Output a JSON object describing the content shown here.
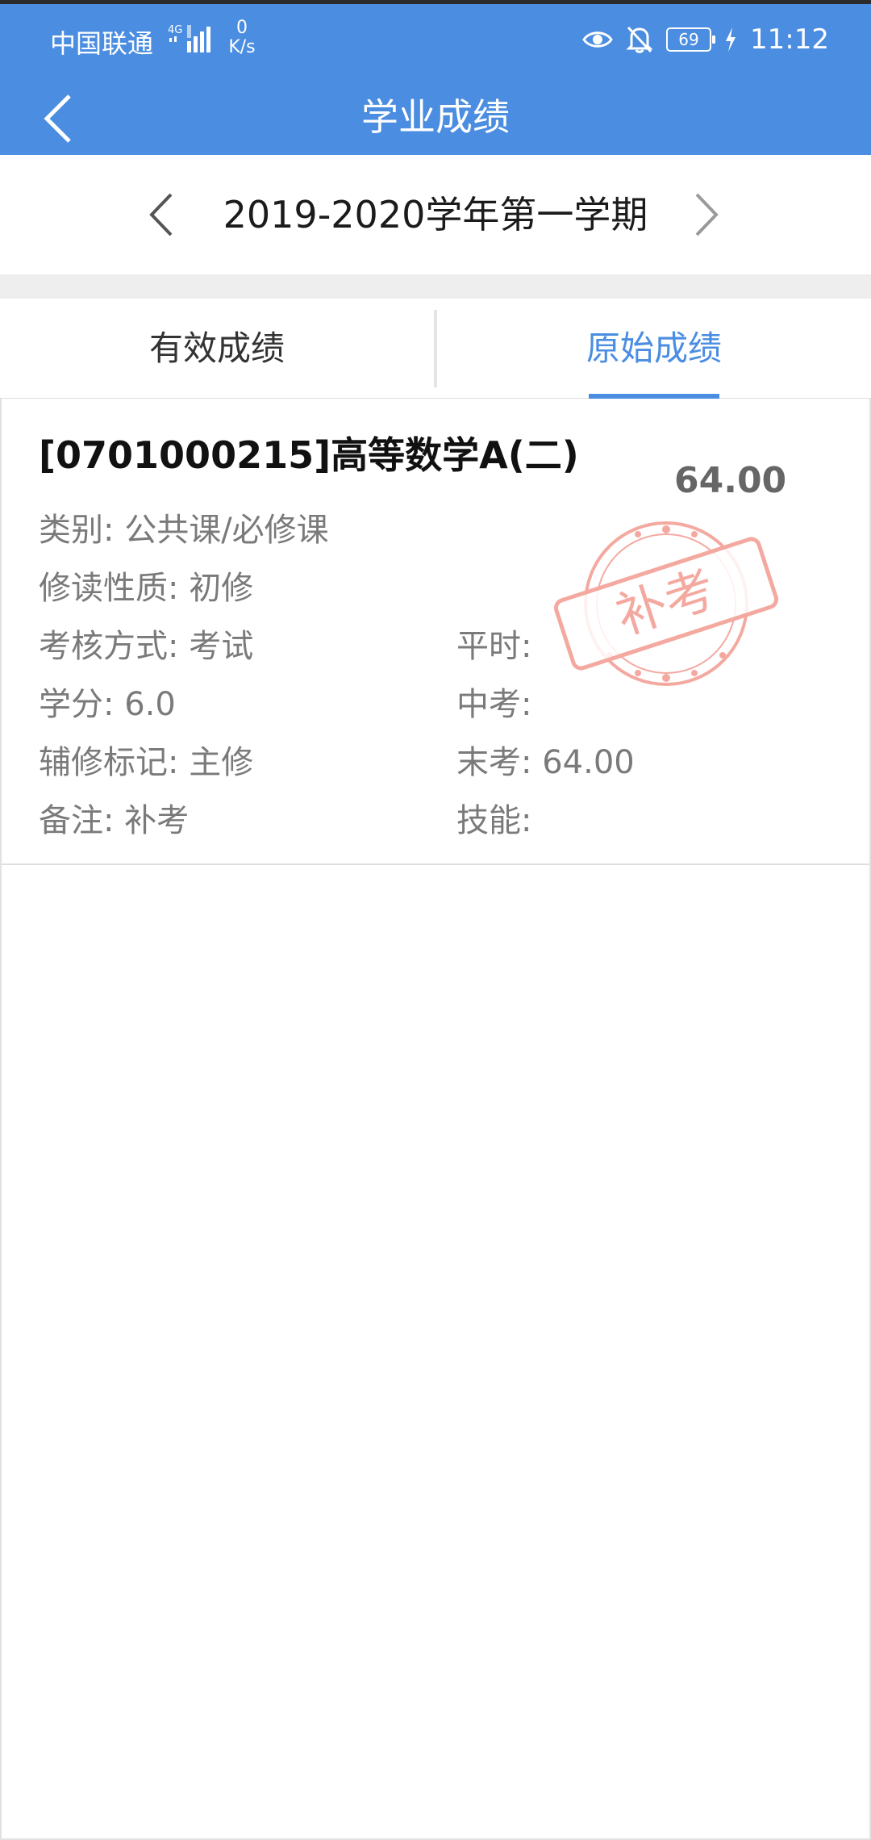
{
  "status_bar": {
    "carrier": "中国联通",
    "network": "4G",
    "speed_value": "0",
    "speed_unit": "K/s",
    "battery": "69",
    "time": "11:12",
    "icons": [
      "eye-icon",
      "bell-off-icon",
      "battery-icon",
      "charging-icon"
    ]
  },
  "header": {
    "title": "学业成绩",
    "back_icon": "back-arrow-icon"
  },
  "term": {
    "label": "2019-2020学年第一学期",
    "prev_icon": "chevron-left-icon",
    "next_icon": "chevron-right-icon"
  },
  "tabs": [
    {
      "label": "有效成绩",
      "active": false
    },
    {
      "label": "原始成绩",
      "active": true
    }
  ],
  "course": {
    "title": "[0701000215]高等数学A(二)",
    "score": "64.00",
    "fields_left": [
      {
        "key": "类别:",
        "value": "公共课/必修课"
      },
      {
        "key": "修读性质:",
        "value": "初修"
      },
      {
        "key": "考核方式:",
        "value": "考试"
      },
      {
        "key": "学分:",
        "value": "6.0"
      },
      {
        "key": "辅修标记:",
        "value": "主修"
      },
      {
        "key": "备注:",
        "value": "补考"
      }
    ],
    "fields_right": [
      {
        "key": "平时:",
        "value": ""
      },
      {
        "key": "中考:",
        "value": ""
      },
      {
        "key": "末考:",
        "value": "64.00"
      },
      {
        "key": "技能:",
        "value": ""
      }
    ],
    "stamp_text": "补考",
    "stamp_color": "#f4a9a0"
  },
  "colors": {
    "primary": "#4a8de1",
    "gap": "#eeeeee"
  }
}
